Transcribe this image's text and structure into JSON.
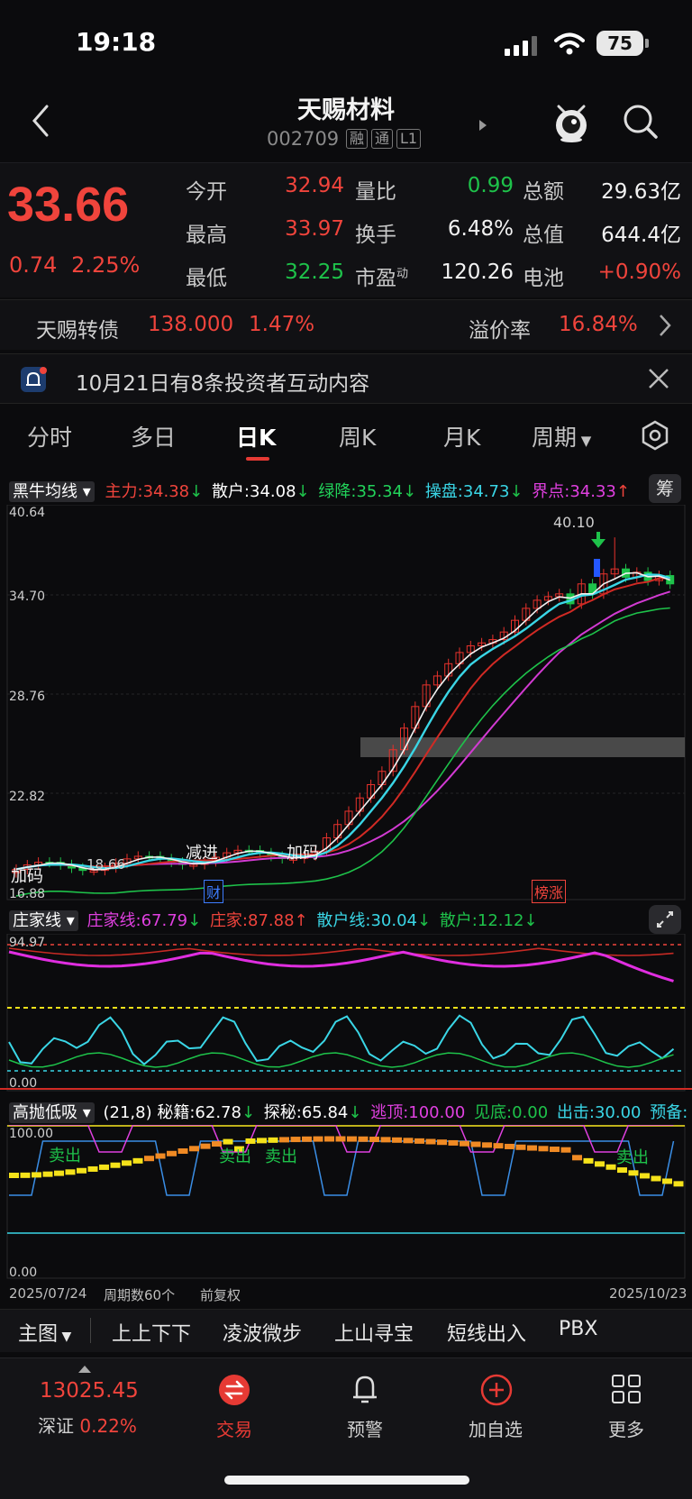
{
  "status": {
    "time": "19:18",
    "battery": "75"
  },
  "header": {
    "name": "天赐材料",
    "code": "002709",
    "tags": [
      "融",
      "通",
      "L1"
    ]
  },
  "quote": {
    "price": "33.66",
    "change": "0.74",
    "change_pct": "2.25%",
    "fields": [
      {
        "label": "今开",
        "value": "32.94",
        "label2": "量比",
        "value2": "0.99",
        "label3": "总额",
        "value3": "29.63亿"
      },
      {
        "label": "最高",
        "value": "33.97",
        "label2": "换手",
        "value2": "6.48%",
        "label3": "总值",
        "value3": "644.4亿"
      },
      {
        "label": "最低",
        "value": "32.25",
        "label2": "市盈",
        "value2": "120.26",
        "label3": "电池",
        "value3": "+0.90%"
      }
    ],
    "pe_sup": "动"
  },
  "bond": {
    "name": "天赐转债",
    "price": "138.000",
    "pct": "1.47%",
    "premium_label": "溢价率",
    "premium": "16.84%"
  },
  "notice": {
    "text": "10月21日有8条投资者互动内容"
  },
  "tabs": [
    "分时",
    "多日",
    "日K",
    "周K",
    "月K",
    "周期"
  ],
  "main_indicator": {
    "name": "黑牛均线",
    "items": [
      {
        "label": "主力:34.38",
        "arrow": "↓"
      },
      {
        "label": "散户:34.08",
        "arrow": "↓"
      },
      {
        "label": "绿降:35.34",
        "arrow": "↓"
      },
      {
        "label": "操盘:34.73",
        "arrow": "↓"
      },
      {
        "label": "界点:34.33",
        "arrow": "↑"
      }
    ],
    "right_btn": "筹",
    "yticks": [
      "40.64",
      "34.70",
      "28.76",
      "22.82",
      "16.88"
    ],
    "peak_label": "40.10",
    "low_label": "18.66",
    "marks": [
      "加码",
      "减进",
      "加码"
    ],
    "badges": [
      "财",
      "榜涨"
    ]
  },
  "ind2": {
    "name": "庄家线",
    "items": [
      {
        "label": "庄家线:67.79",
        "arrow": "↓"
      },
      {
        "label": "庄家:87.88",
        "arrow": "↑"
      },
      {
        "label": "散户线:30.04",
        "arrow": "↓"
      },
      {
        "label": "散户:12.12",
        "arrow": "↓"
      }
    ],
    "ytop": "94.97",
    "ybot": "0.00"
  },
  "ind3": {
    "name": "高抛低吸",
    "items": [
      {
        "label": "(21,8) 秘籍:62.78",
        "arrow": "↓"
      },
      {
        "label": "探秘:65.84",
        "arrow": "↓"
      },
      {
        "label": "逃顶:100.00",
        "arrow": ""
      },
      {
        "label": "见底:0.00",
        "arrow": ""
      },
      {
        "label": "出击:30.00",
        "arrow": ""
      },
      {
        "label": "预备:",
        "arrow": ""
      }
    ],
    "ytop": "100.00",
    "ybot": "0.00",
    "marks": [
      "卖出",
      "卖出",
      "卖出",
      "卖出"
    ]
  },
  "footer_axis": {
    "start": "2025/07/24",
    "period": "周期数60个",
    "adj": "前复权",
    "end": "2025/10/23"
  },
  "sub_tabs": [
    "主图",
    "上上下下",
    "凌波微步",
    "上山寻宝",
    "短线出入",
    "PBX"
  ],
  "bottom_nav": {
    "index_value": "13025.45",
    "index_name": "深证",
    "index_pct": "0.22%",
    "items": [
      "交易",
      "预警",
      "加自选",
      "更多"
    ]
  },
  "colors": {
    "up": "#f0443c",
    "down": "#1ec24a",
    "accent": "#e63a34",
    "bg": "#0b0b0d"
  }
}
